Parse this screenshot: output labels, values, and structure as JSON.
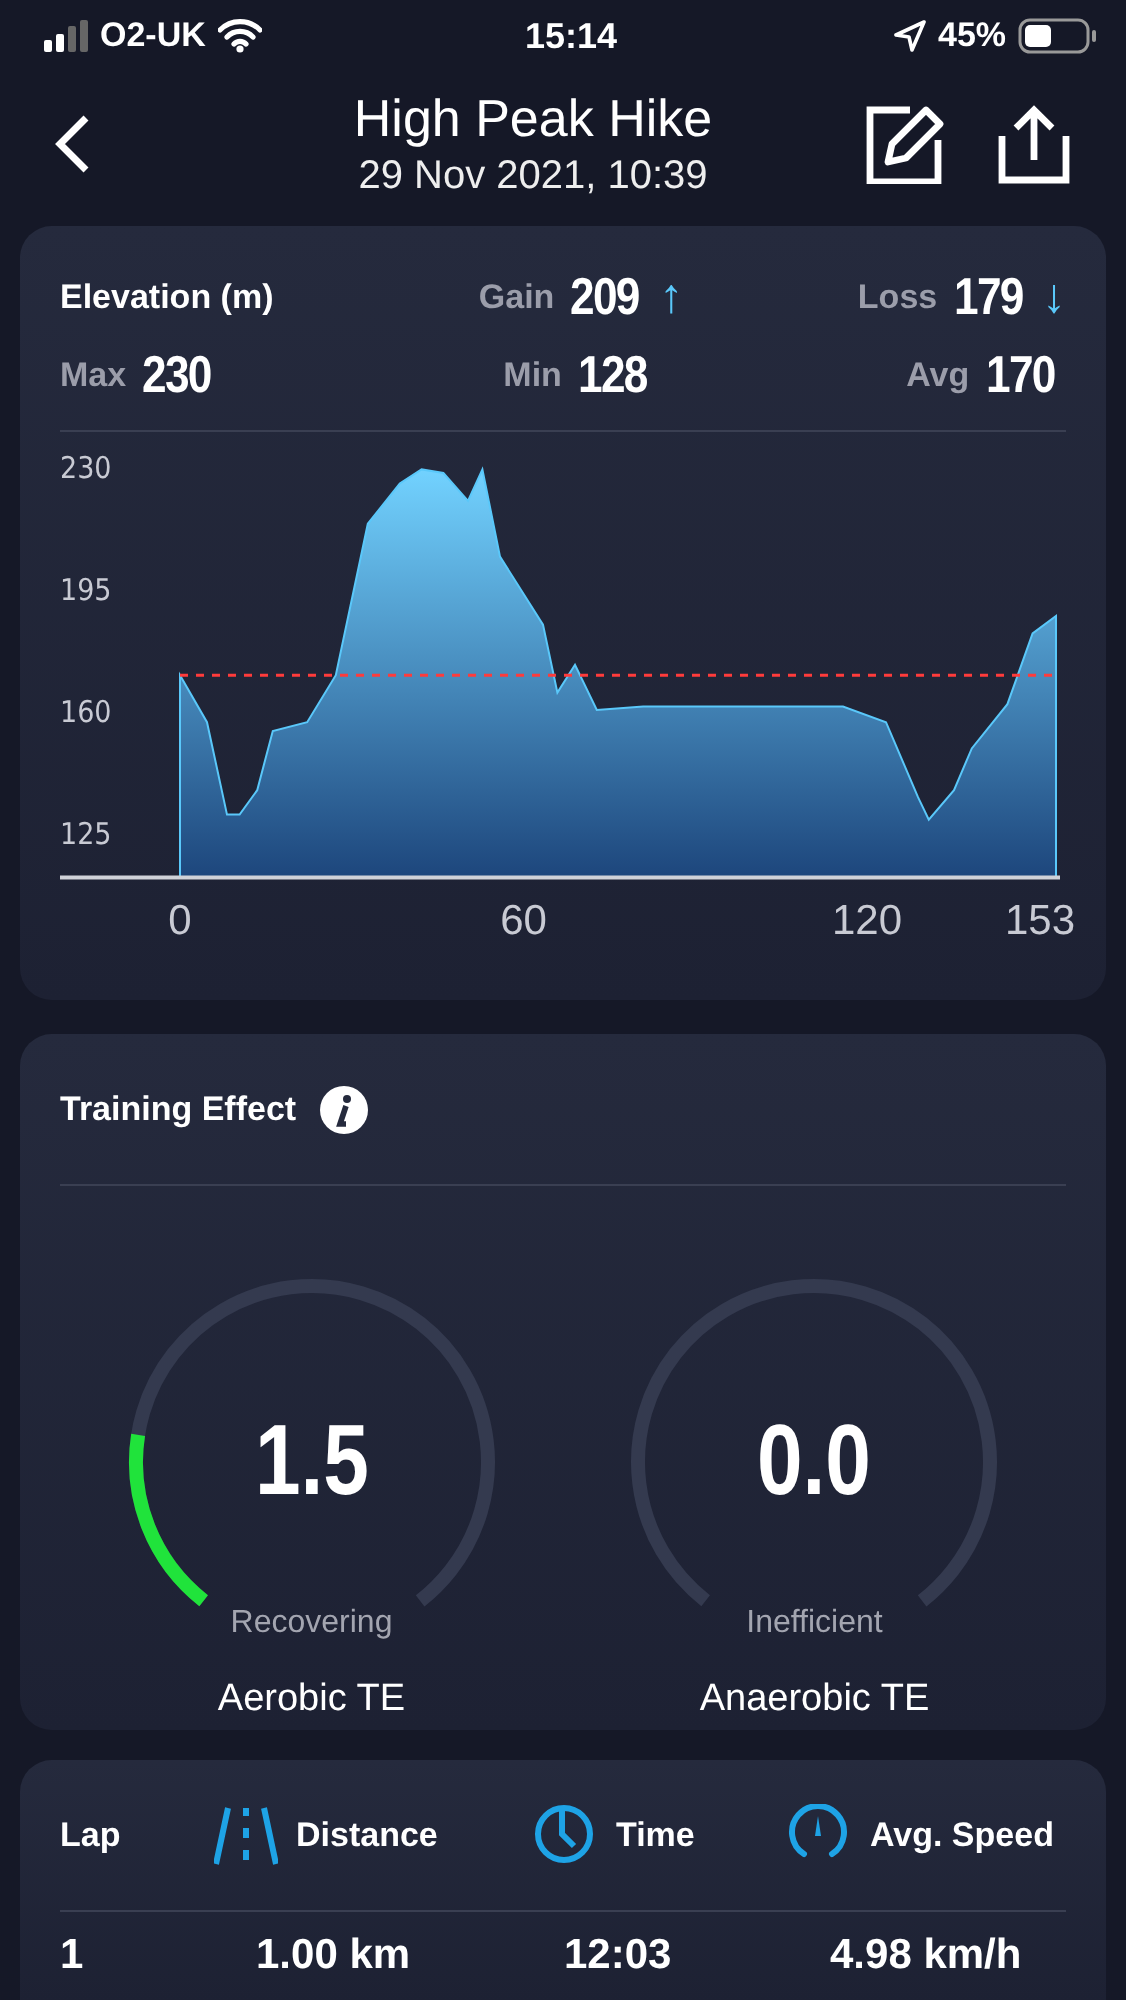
{
  "status_bar": {
    "carrier": "O2-UK",
    "time": "15:14",
    "battery": "45%"
  },
  "header": {
    "title": "High Peak Hike",
    "subtitle": "29 Nov 2021, 10:39"
  },
  "elevation": {
    "title": "Elevation (m)",
    "stats": [
      {
        "label": "Gain",
        "value": "209",
        "arrow": "↑"
      },
      {
        "label": "Loss",
        "value": "179",
        "arrow": "↓"
      },
      {
        "label": "Max",
        "value": "230"
      },
      {
        "label": "Min",
        "value": "128"
      },
      {
        "label": "Avg",
        "value": "170"
      }
    ],
    "chart_data": {
      "type": "area",
      "xlim": [
        0,
        153
      ],
      "ylim": [
        112,
        230
      ],
      "xticks": [
        0,
        60,
        120,
        153
      ],
      "yticks": [
        125,
        160,
        195,
        230
      ],
      "x": [
        0,
        4.7,
        8.2,
        10.4,
        13.5,
        16.2,
        22.2,
        27.2,
        32.8,
        38.4,
        42.2,
        46,
        50.3,
        52.8,
        55.9,
        63.4,
        65.9,
        69,
        72.8,
        80.9,
        115.8,
        123.3,
        128.9,
        130.8,
        135.2,
        138.3,
        144.5,
        148.9,
        153
      ],
      "series": [
        {
          "color": "#5ac8fa",
          "values": [
            170,
            156.5,
            130,
            130,
            137,
            154,
            156.5,
            170,
            213.4,
            225,
            229,
            228,
            220,
            229,
            204,
            184.5,
            165,
            173,
            160,
            161,
            161,
            156.5,
            135,
            128.6,
            137,
            149,
            161.7,
            182,
            187
          ]
        }
      ],
      "ref_lines": [
        {
          "axis": "y",
          "value": 170,
          "color": "#ff3b3b"
        }
      ]
    }
  },
  "training": {
    "title": "Training Effect",
    "gauges": [
      {
        "value": "1.5",
        "status": "Recovering",
        "label": "Aerobic TE"
      },
      {
        "value": "0.0",
        "status": "Inefficient",
        "label": "Anaerobic TE"
      }
    ]
  },
  "laps": {
    "columns": [
      "Lap",
      "Distance",
      "Time",
      "Avg. Speed"
    ],
    "rows": [
      [
        "1",
        "1.00 km",
        "12:03",
        "4.98 km/h"
      ]
    ]
  }
}
